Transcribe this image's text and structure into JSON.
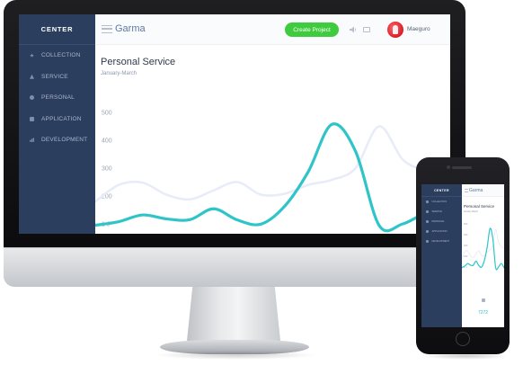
{
  "brand": "CENTER",
  "sidebar": {
    "items": [
      {
        "label": "COLLECTION",
        "icon": "star-icon"
      },
      {
        "label": "SERVICE",
        "icon": "triangle-icon"
      },
      {
        "label": "PERSONAL",
        "icon": "circle-icon"
      },
      {
        "label": "APPLICATION",
        "icon": "square-icon"
      },
      {
        "label": "DEVELOPMENT",
        "icon": "bars-icon"
      }
    ]
  },
  "header": {
    "app_title": "Garma",
    "create_button": "Create Project",
    "user_name": "Maeguro"
  },
  "colors": {
    "sidebar_bg": "#2c3e5e",
    "accent_green": "#3ecb3e",
    "line_primary": "#2ec4c8",
    "line_secondary": "#e8ecf8"
  },
  "chart_data": {
    "type": "line",
    "title": "Personal Service",
    "subtitle": "January-March",
    "y_ticks": [
      "500",
      "400",
      "300",
      "200",
      "1 J"
    ],
    "ylim": [
      0,
      500
    ],
    "grid": false,
    "series": [
      {
        "values": [
          95,
          108,
          132,
          118,
          115,
          154,
          114,
          99,
          163,
          287,
          457,
          360,
          94,
          100,
          133,
          92
        ]
      },
      {
        "values": [
          180,
          240,
          248,
          205,
          188,
          220,
          250,
          205,
          208,
          240,
          258,
          300,
          450,
          330,
          290,
          270
        ]
      }
    ]
  },
  "phone": {
    "brand": "CENTER",
    "app_title": "Garma",
    "chart_title": "Personal Service",
    "chart_subtitle": "January-March",
    "nav_items": [
      "COLLECTION",
      "SERVICE",
      "PERSONAL",
      "APPLICATION",
      "DEVELOPMENT"
    ],
    "stat_value": "7272"
  }
}
